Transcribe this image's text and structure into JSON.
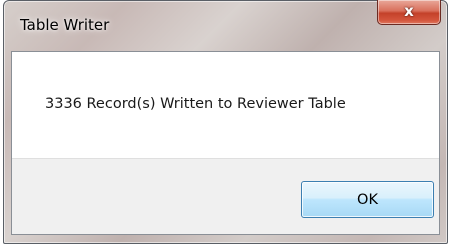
{
  "window": {
    "title": "Table Writer",
    "close_icon": "close-icon",
    "close_glyph": "x"
  },
  "dialog": {
    "message": "3336 Record(s) Written to Reviewer Table",
    "ok_label": "OK"
  },
  "colors": {
    "close_button": "#c4412a",
    "ok_button_border": "#3c7fb1",
    "footer_background": "#f0f0f0"
  }
}
